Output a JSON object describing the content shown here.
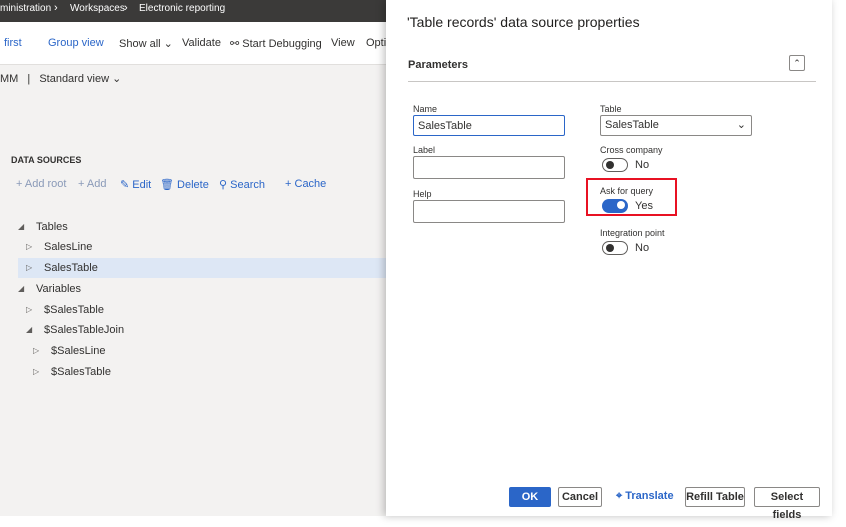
{
  "breadcrumb": [
    "ministration",
    "Workspaces",
    "Electronic reporting"
  ],
  "actions": [
    "first",
    "Group view",
    "Show all",
    "Validate",
    "Start Debugging",
    "View",
    "Opti"
  ],
  "view": {
    "prefix": "MM",
    "selector": "Standard view"
  },
  "data_sources": {
    "heading": "DATA SOURCES",
    "toolbar": [
      "Add root",
      "Add",
      "Edit",
      "Delete",
      "Search",
      "Cache"
    ],
    "tree": [
      {
        "label": "Tables",
        "expanded": true
      },
      {
        "label": "SalesLine",
        "expanded": false
      },
      {
        "label": "SalesTable",
        "expanded": false,
        "selected": true
      },
      {
        "label": "Variables",
        "expanded": true
      },
      {
        "label": "$SalesTable",
        "expanded": false
      },
      {
        "label": "$SalesTableJoin",
        "expanded": true
      },
      {
        "label": "$SalesLine",
        "expanded": false
      },
      {
        "label": "$SalesTable",
        "expanded": false
      }
    ]
  },
  "dialog": {
    "title": "'Table records' data source properties",
    "section": "Parameters",
    "name_label": "Name",
    "name_value": "SalesTable",
    "label_label": "Label",
    "label_value": "",
    "help_label": "Help",
    "help_value": "",
    "table_label": "Table",
    "table_value": "SalesTable",
    "cross_company_label": "Cross company",
    "cross_company_state": "No",
    "ask_query_label": "Ask for query",
    "ask_query_state": "Yes",
    "integration_label": "Integration point",
    "integration_state": "No",
    "buttons": {
      "ok": "OK",
      "cancel": "Cancel",
      "translate": "Translate",
      "refill": "Refill Table",
      "select_fields": "Select fields"
    }
  },
  "colors": {
    "accent": "#2b66c8",
    "highlight": "#e81123"
  }
}
